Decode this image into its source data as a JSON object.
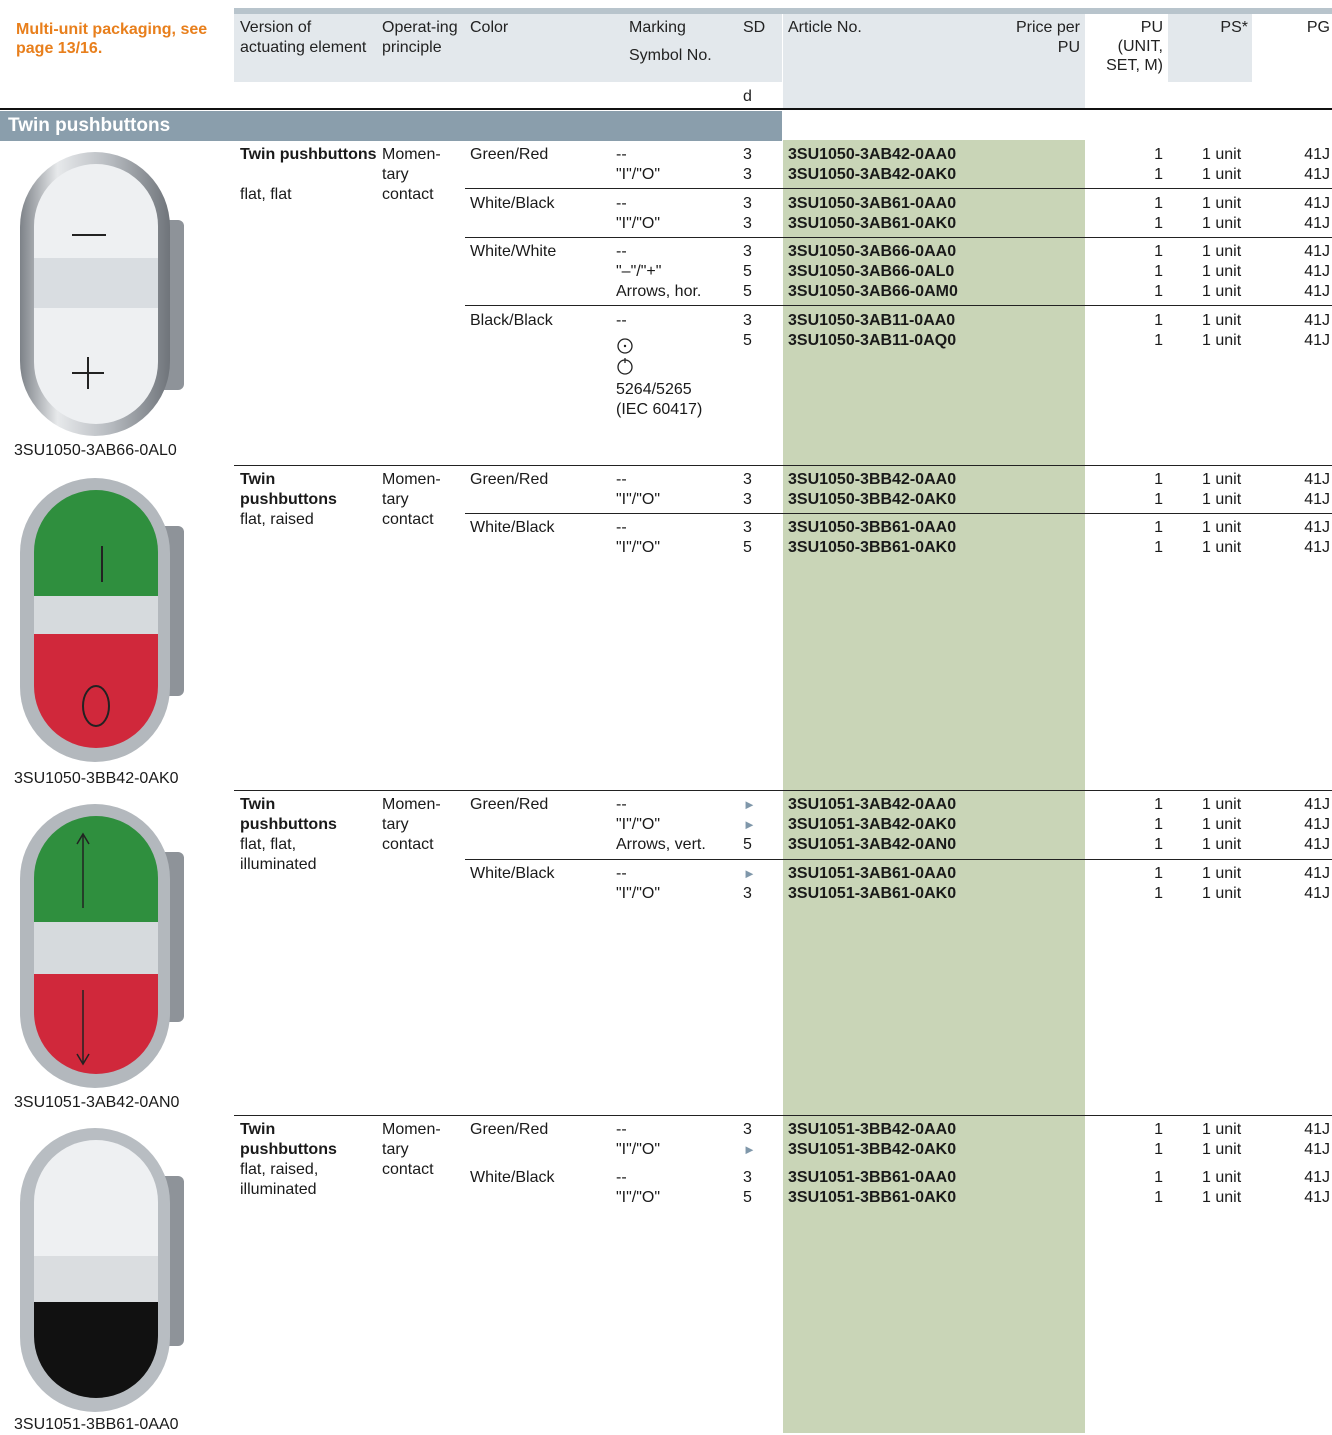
{
  "note": "Multi-unit packaging, see page 13/16.",
  "headers": {
    "version": "Version of actuating element",
    "principle": "Operat-ing principle",
    "color": "Color",
    "marking": "Marking Symbol No.",
    "sd": "SD",
    "sd_unit": "d",
    "article": "Article No.",
    "price": "Price per PU",
    "pu": "PU (UNIT, SET, M)",
    "ps": "PS*",
    "pg": "PG"
  },
  "section_title": "Twin pushbuttons",
  "groups": [
    {
      "caption": "3SU1050-3AB66-0AL0",
      "version_bold": "Twin pushbuttons",
      "version_rest": "flat, flat",
      "principle": "Momen-tary contact",
      "colors": [
        {
          "color": "Green/Red",
          "rows": [
            {
              "marking": "--",
              "sd": "3",
              "article": "3SU1050-3AB42-0AA0",
              "pu": "1",
              "ps": "1 unit",
              "pg": "41J"
            },
            {
              "marking": "\"I\"/\"O\"",
              "sd": "3",
              "article": "3SU1050-3AB42-0AK0",
              "pu": "1",
              "ps": "1 unit",
              "pg": "41J"
            }
          ]
        },
        {
          "color": "White/Black",
          "rows": [
            {
              "marking": "--",
              "sd": "3",
              "article": "3SU1050-3AB61-0AA0",
              "pu": "1",
              "ps": "1 unit",
              "pg": "41J"
            },
            {
              "marking": "\"I\"/\"O\"",
              "sd": "3",
              "article": "3SU1050-3AB61-0AK0",
              "pu": "1",
              "ps": "1 unit",
              "pg": "41J"
            }
          ]
        },
        {
          "color": "White/White",
          "rows": [
            {
              "marking": "--",
              "sd": "3",
              "article": "3SU1050-3AB66-0AA0",
              "pu": "1",
              "ps": "1 unit",
              "pg": "41J"
            },
            {
              "marking": "\"–\"/\"+\"",
              "sd": "5",
              "article": "3SU1050-3AB66-0AL0",
              "pu": "1",
              "ps": "1 unit",
              "pg": "41J"
            },
            {
              "marking": "Arrows, hor.",
              "sd": "5",
              "article": "3SU1050-3AB66-0AM0",
              "pu": "1",
              "ps": "1 unit",
              "pg": "41J"
            }
          ]
        },
        {
          "color": "Black/Black",
          "rows": [
            {
              "marking": "--",
              "sd": "3",
              "article": "3SU1050-3AB11-0AA0",
              "pu": "1",
              "ps": "1 unit",
              "pg": "41J"
            },
            {
              "marking": "",
              "sd": "5",
              "article": "3SU1050-3AB11-0AQ0",
              "pu": "1",
              "ps": "1 unit",
              "pg": "41J"
            }
          ]
        }
      ],
      "extra_marking": [
        "5264/5265",
        "(IEC 60417)"
      ]
    },
    {
      "caption": "3SU1050-3BB42-0AK0",
      "version_bold": "Twin pushbuttons",
      "version_rest": "flat, raised",
      "principle": "Momen-tary contact",
      "colors": [
        {
          "color": "Green/Red",
          "rows": [
            {
              "marking": "--",
              "sd": "3",
              "article": "3SU1050-3BB42-0AA0",
              "pu": "1",
              "ps": "1 unit",
              "pg": "41J"
            },
            {
              "marking": "\"I\"/\"O\"",
              "sd": "3",
              "article": "3SU1050-3BB42-0AK0",
              "pu": "1",
              "ps": "1 unit",
              "pg": "41J"
            }
          ]
        },
        {
          "color": "White/Black",
          "rows": [
            {
              "marking": "--",
              "sd": "3",
              "article": "3SU1050-3BB61-0AA0",
              "pu": "1",
              "ps": "1 unit",
              "pg": "41J"
            },
            {
              "marking": "\"I\"/\"O\"",
              "sd": "5",
              "article": "3SU1050-3BB61-0AK0",
              "pu": "1",
              "ps": "1 unit",
              "pg": "41J"
            }
          ]
        }
      ]
    },
    {
      "caption": "3SU1051-3AB42-0AN0",
      "version_bold": "Twin pushbuttons",
      "version_rest": "flat, flat, illuminated",
      "principle": "Momen-tary contact",
      "colors": [
        {
          "color": "Green/Red",
          "rows": [
            {
              "marking": "--",
              "sd": "►",
              "article": "3SU1051-3AB42-0AA0",
              "pu": "1",
              "ps": "1 unit",
              "pg": "41J"
            },
            {
              "marking": "\"I\"/\"O\"",
              "sd": "►",
              "article": "3SU1051-3AB42-0AK0",
              "pu": "1",
              "ps": "1 unit",
              "pg": "41J"
            },
            {
              "marking": "Arrows, vert.",
              "sd": "5",
              "article": "3SU1051-3AB42-0AN0",
              "pu": "1",
              "ps": "1 unit",
              "pg": "41J"
            }
          ]
        },
        {
          "color": "White/Black",
          "rows": [
            {
              "marking": "--",
              "sd": "►",
              "article": "3SU1051-3AB61-0AA0",
              "pu": "1",
              "ps": "1 unit",
              "pg": "41J"
            },
            {
              "marking": "\"I\"/\"O\"",
              "sd": "3",
              "article": "3SU1051-3AB61-0AK0",
              "pu": "1",
              "ps": "1 unit",
              "pg": "41J"
            }
          ]
        }
      ]
    },
    {
      "caption": "3SU1051-3BB61-0AA0",
      "version_bold": "Twin pushbuttons",
      "version_rest": "flat, raised, illuminated",
      "principle": "Momen-tary contact",
      "colors": [
        {
          "color": "Green/Red",
          "rows": [
            {
              "marking": "--",
              "sd": "3",
              "article": "3SU1051-3BB42-0AA0",
              "pu": "1",
              "ps": "1 unit",
              "pg": "41J"
            },
            {
              "marking": "\"I\"/\"O\"",
              "sd": "►",
              "article": "3SU1051-3BB42-0AK0",
              "pu": "1",
              "ps": "1 unit",
              "pg": "41J"
            }
          ]
        },
        {
          "color": "White/Black",
          "rows": [
            {
              "marking": "--",
              "sd": "3",
              "article": "3SU1051-3BB61-0AA0",
              "pu": "1",
              "ps": "1 unit",
              "pg": "41J"
            },
            {
              "marking": "\"I\"/\"O\"",
              "sd": "5",
              "article": "3SU1051-3BB61-0AK0",
              "pu": "1",
              "ps": "1 unit",
              "pg": "41J"
            }
          ]
        }
      ]
    }
  ],
  "colors": {
    "note": "#e87f1c",
    "section": "#8a9eac",
    "article_bg": "#c9d5b7",
    "header_bg": "#e3e8ec",
    "sd_arrow": "#7f97aa"
  }
}
